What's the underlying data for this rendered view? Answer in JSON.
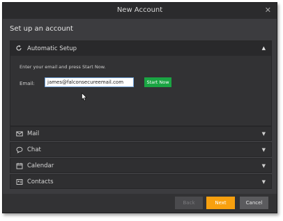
{
  "window": {
    "title": "New Account",
    "close_glyph": "✕"
  },
  "heading": "Set up an account",
  "automatic_setup": {
    "label": "Automatic Setup",
    "icon": "refresh-icon",
    "expanded": true,
    "instruction": "Enter your email and press Start Now.",
    "email_label": "Email:",
    "email_value": "james@falconsecureemail.com",
    "start_button": "Start Now"
  },
  "sections": [
    {
      "label": "Mail",
      "icon": "envelope-icon"
    },
    {
      "label": "Chat",
      "icon": "chat-bubble-icon"
    },
    {
      "label": "Calendar",
      "icon": "calendar-icon"
    },
    {
      "label": "Contacts",
      "icon": "contacts-card-icon"
    }
  ],
  "footer": {
    "back": "Back",
    "next": "Next",
    "cancel": "Cancel"
  },
  "colors": {
    "window_bg": "#3c3c3f",
    "titlebar": "#2b2b2d",
    "start_button": "#1aa543",
    "next_button": "#f7a00f",
    "cancel_button": "#5b5b5e"
  }
}
